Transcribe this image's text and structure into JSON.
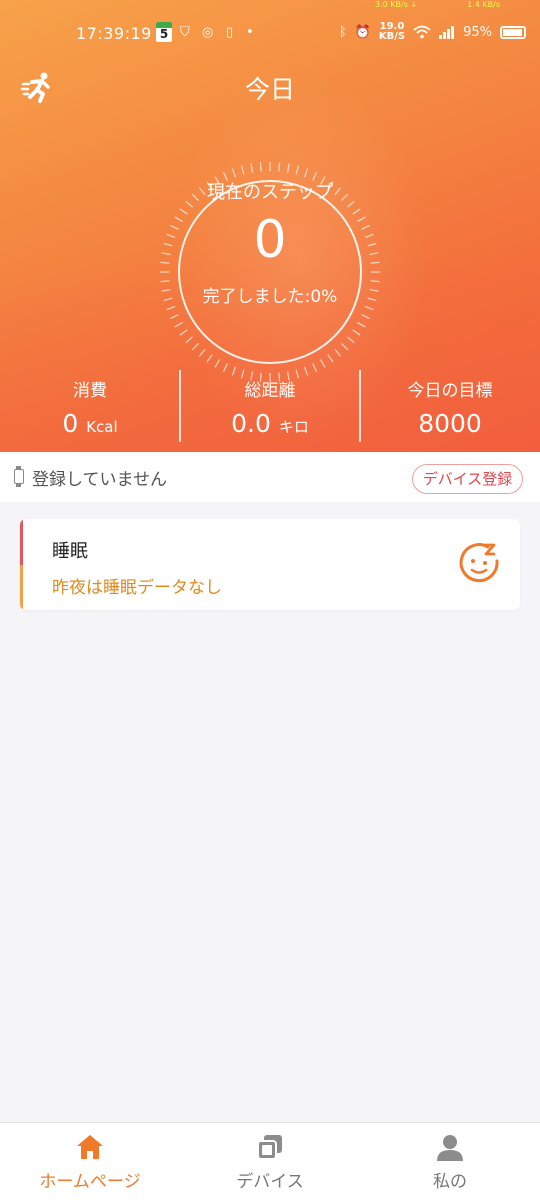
{
  "status_bar": {
    "time": "17:39:19",
    "calendar_day": "5",
    "net_speed_value": "19.0",
    "net_speed_unit": "KB/S",
    "battery": "95%",
    "top_strip_left": "3.0 KB/s ↓",
    "top_strip_right": "1.4 KB/s"
  },
  "header": {
    "title": "今日",
    "icon": "running-person-icon"
  },
  "ring": {
    "label": "現在のステップ",
    "value": "0",
    "done_text": "完了しました:0%",
    "progress": 0
  },
  "stats": [
    {
      "label": "消費",
      "value": "0",
      "unit": "Kcal"
    },
    {
      "label": "総距離",
      "value": "0.0",
      "unit": "キロ"
    },
    {
      "label": "今日の目標",
      "value": "8000",
      "unit": ""
    }
  ],
  "device_bar": {
    "status_text": "登録していません",
    "register_button": "デバイス登録",
    "icon": "watch-icon"
  },
  "sleep_card": {
    "title": "睡眠",
    "subtitle": "昨夜は睡眠データなし",
    "icon": "sleep-face-icon"
  },
  "nav": [
    {
      "label": "ホームページ",
      "icon": "home-icon",
      "active": true
    },
    {
      "label": "デバイス",
      "icon": "device-icon",
      "active": false
    },
    {
      "label": "私の",
      "icon": "person-icon",
      "active": false
    }
  ],
  "colors": {
    "accent": "#f07a2a",
    "hero_top": "#f7a24a",
    "hero_bottom": "#f2603b",
    "danger": "#e0474c",
    "sleep_subtitle": "#e08a1e"
  }
}
